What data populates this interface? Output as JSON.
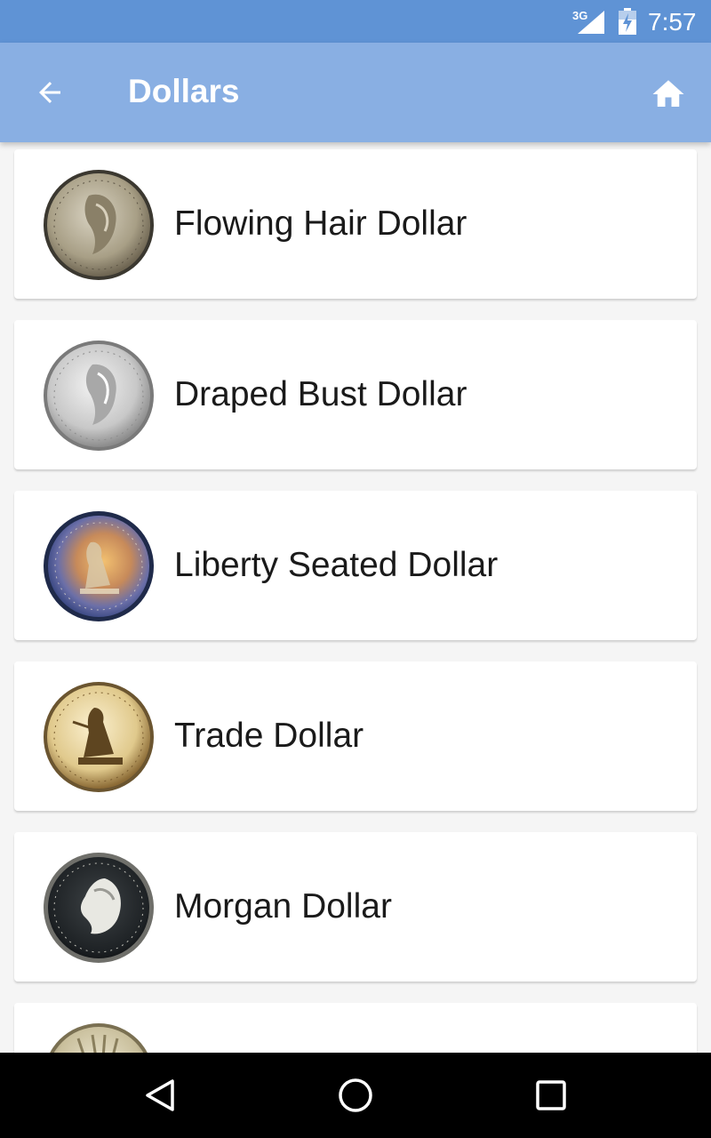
{
  "status_bar": {
    "network": "3G",
    "time": "7:57",
    "signal_icon": "cell-signal-icon",
    "battery_icon": "battery-charging-icon",
    "color": "#5f93d5"
  },
  "app_bar": {
    "title": "Dollars",
    "back_icon": "arrow-back-icon",
    "home_icon": "home-icon",
    "color": "#89afe3"
  },
  "coins": [
    {
      "label": "Flowing Hair Dollar",
      "icon": "flowing-hair-coin-image"
    },
    {
      "label": "Draped Bust Dollar",
      "icon": "draped-bust-coin-image"
    },
    {
      "label": "Liberty Seated Dollar",
      "icon": "liberty-seated-coin-image"
    },
    {
      "label": "Trade Dollar",
      "icon": "trade-dollar-coin-image"
    },
    {
      "label": "Morgan Dollar",
      "icon": "morgan-dollar-coin-image"
    },
    {
      "label": "",
      "icon": "peace-dollar-coin-image"
    }
  ],
  "nav_bar": {
    "back_icon": "nav-back-icon",
    "home_icon": "nav-home-icon",
    "recents_icon": "nav-recents-icon"
  }
}
